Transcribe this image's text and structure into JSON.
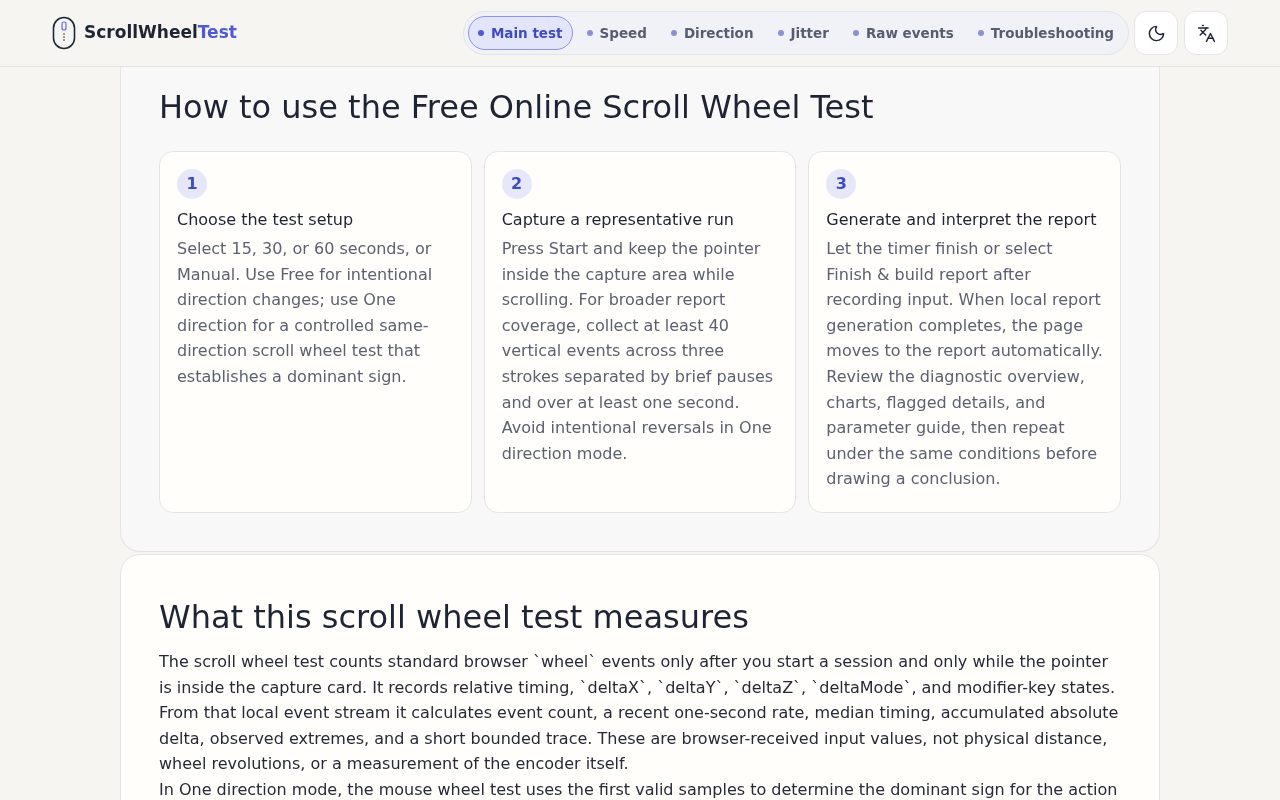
{
  "brand": {
    "name": "ScrollWheel",
    "accent": "Test"
  },
  "nav": [
    {
      "label": "Main test",
      "selected": true
    },
    {
      "label": "Speed",
      "selected": false
    },
    {
      "label": "Direction",
      "selected": false
    },
    {
      "label": "Jitter",
      "selected": false
    },
    {
      "label": "Raw events",
      "selected": false
    },
    {
      "label": "Troubleshooting",
      "selected": false
    }
  ],
  "how_to": {
    "title": "How to use the Free Online Scroll Wheel Test",
    "steps": [
      {
        "number": "1",
        "title": "Choose the test setup",
        "text": "Select 15, 30, or 60 seconds, or Manual. Use Free for intentional direction changes; use One direction for a controlled same-direction scroll wheel test that establishes a dominant sign."
      },
      {
        "number": "2",
        "title": "Capture a representative run",
        "text": "Press Start and keep the pointer inside the capture area while scrolling. For broader report coverage, collect at least 40 vertical events across three strokes separated by brief pauses and over at least one second. Avoid intentional reversals in One direction mode."
      },
      {
        "number": "3",
        "title": "Generate and interpret the report",
        "text": "Let the timer finish or select Finish & build report after recording input. When local report generation completes, the page moves to the report automatically. Review the diagnostic overview, charts, flagged details, and parameter guide, then repeat under the same conditions before drawing a conclusion."
      }
    ]
  },
  "measures": {
    "title": "What this scroll wheel test measures",
    "paragraphs": [
      "The scroll wheel test counts standard browser `wheel` events only after you start a session and only while the pointer is inside the capture card. It records relative timing, `deltaX`, `deltaY`, `deltaZ`, `deltaMode`, and modifier-key states. From that local event stream it calculates event count, a recent one-second rate, median timing, accumulated absolute delta, observed extremes, and a short bounded trace. These are browser-received input values, not physical distance, wheel revolutions, or a measurement of the encoder itself.",
      "In One direction mode, the mouse wheel test uses the first valid samples to determine the dominant sign for the action"
    ]
  }
}
